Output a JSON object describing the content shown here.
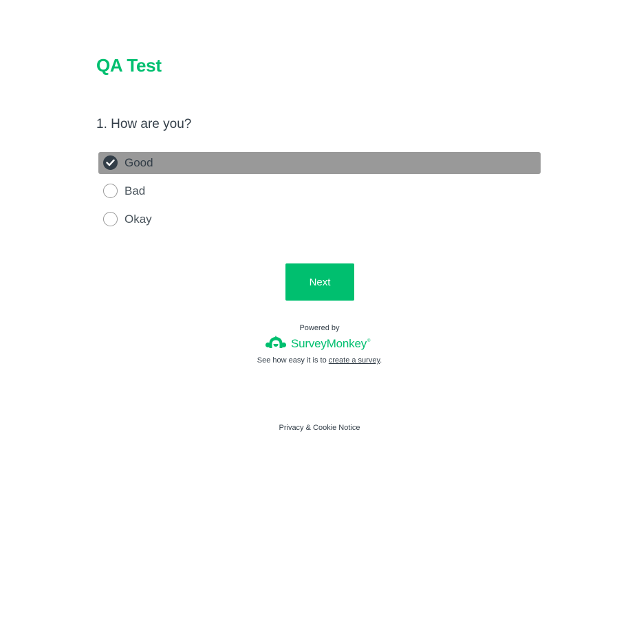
{
  "survey": {
    "title": "QA Test",
    "accent_color": "#00bf6f"
  },
  "question": {
    "text": "1. How are you?",
    "options": [
      {
        "label": "Good",
        "selected": true
      },
      {
        "label": "Bad",
        "selected": false
      },
      {
        "label": "Okay",
        "selected": false
      }
    ]
  },
  "navigation": {
    "next_label": "Next"
  },
  "footer": {
    "powered_by": "Powered by",
    "brand_name": "SurveyMonkey",
    "brand_icon": "surveymonkey-logo-icon",
    "see_how_prefix": "See how easy it is to ",
    "create_link": "create a survey",
    "see_how_suffix": ".",
    "privacy_link": "Privacy & Cookie Notice"
  }
}
